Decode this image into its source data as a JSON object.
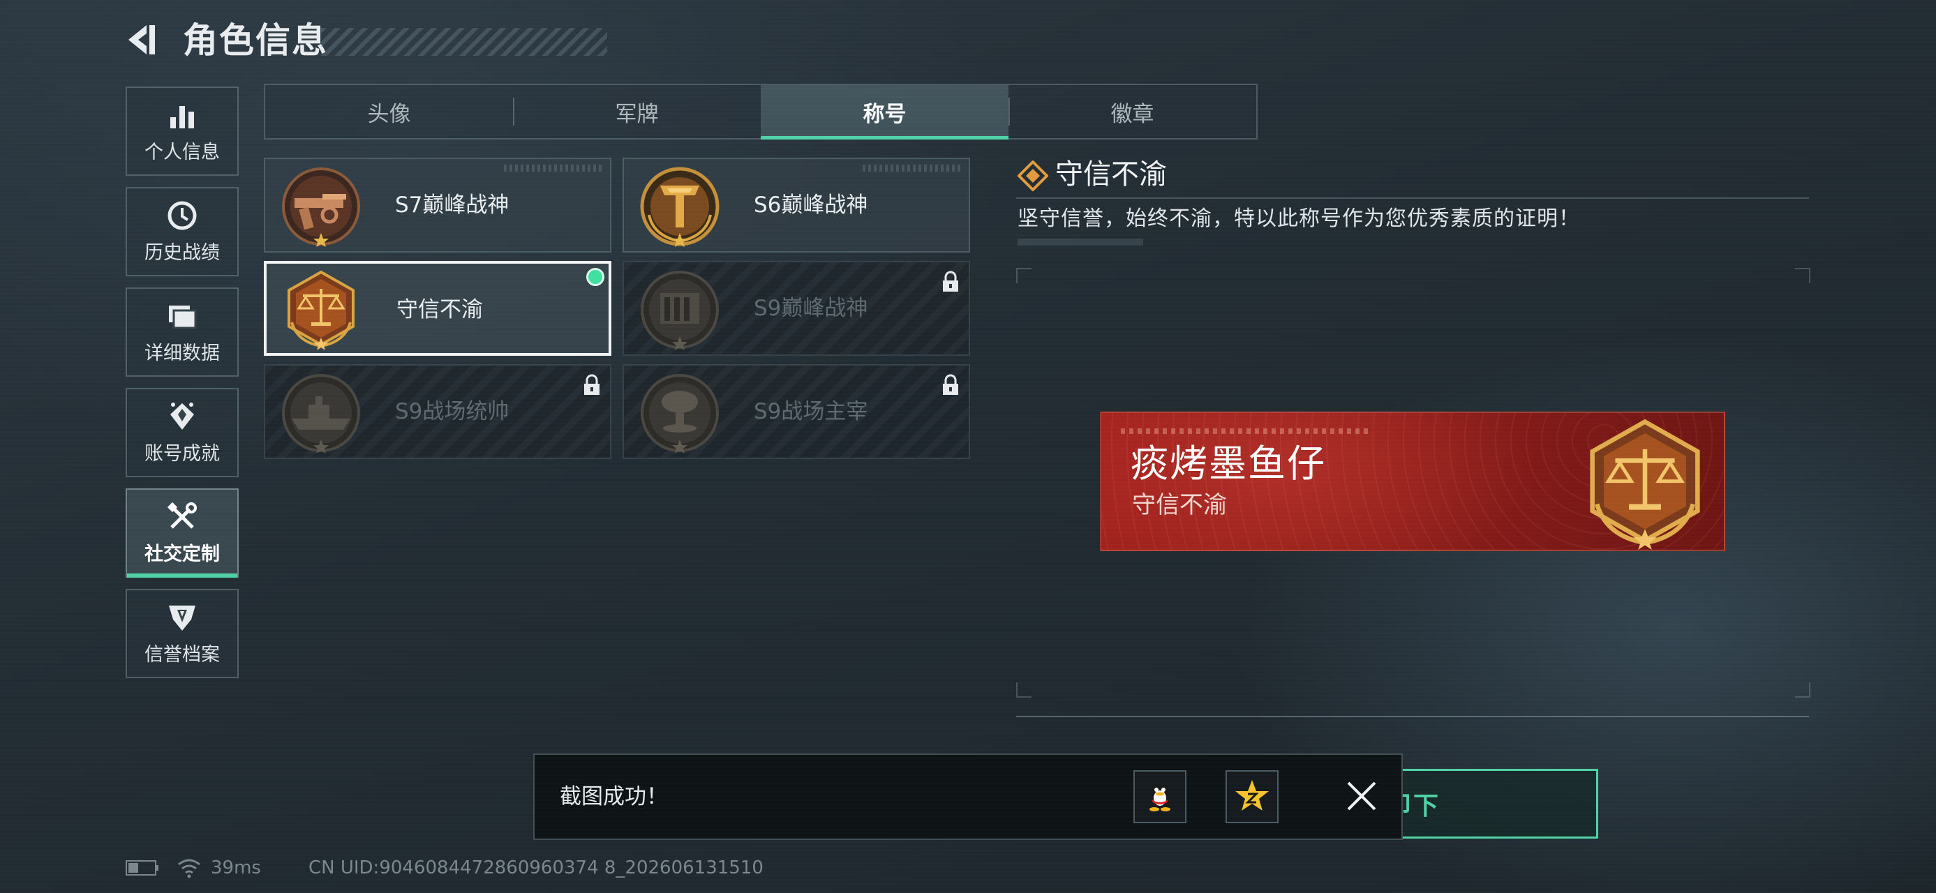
{
  "header": {
    "title": "角色信息",
    "back_icon": "back-arrow-icon"
  },
  "nav": {
    "items": [
      {
        "label": "个人信息",
        "icon": "bar-chart-icon",
        "active": false
      },
      {
        "label": "历史战绩",
        "icon": "history-clock-icon",
        "active": false
      },
      {
        "label": "详细数据",
        "icon": "folder-icon",
        "active": false
      },
      {
        "label": "账号成就",
        "icon": "achievement-icon",
        "active": false
      },
      {
        "label": "社交定制",
        "icon": "tools-icon",
        "active": true
      },
      {
        "label": "信誉档案",
        "icon": "credit-shield-icon",
        "active": false
      }
    ]
  },
  "tabs": {
    "items": [
      {
        "label": "头像",
        "active": false
      },
      {
        "label": "军牌",
        "active": false
      },
      {
        "label": "称号",
        "active": true
      },
      {
        "label": "徽章",
        "active": false
      }
    ]
  },
  "titles": [
    {
      "label": "S7巅峰战神",
      "state": "unlocked",
      "badge": "s7-peak-badge-icon"
    },
    {
      "label": "S6巅峰战神",
      "state": "unlocked",
      "badge": "s6-peak-badge-icon"
    },
    {
      "label": "守信不渝",
      "state": "selected",
      "badge": "scales-badge-icon"
    },
    {
      "label": "S9巅峰战神",
      "state": "locked",
      "badge": "s9-peak-badge-icon"
    },
    {
      "label": "S9战场统帅",
      "state": "locked",
      "badge": "battleship-badge-icon"
    },
    {
      "label": "S9战场主宰",
      "state": "locked",
      "badge": "mushroom-cloud-badge-icon"
    }
  ],
  "detail": {
    "title": "守信不渝",
    "description": "坚守信誉，始终不渝，特以此称号作为您优秀素质的证明！"
  },
  "nameplate": {
    "player_name": "痰烤墨鱼仔",
    "title": "守信不渝"
  },
  "unequip_button": {
    "label": "卸下"
  },
  "toast": {
    "message": "截图成功！"
  },
  "status": {
    "ping": "39ms",
    "uid": "CN UID:9046084472860960374 8_202606131510"
  },
  "colors": {
    "accent": "#4fd2a6",
    "nameplate_red": "#9c201c",
    "badge_gold": "#d9a441"
  }
}
